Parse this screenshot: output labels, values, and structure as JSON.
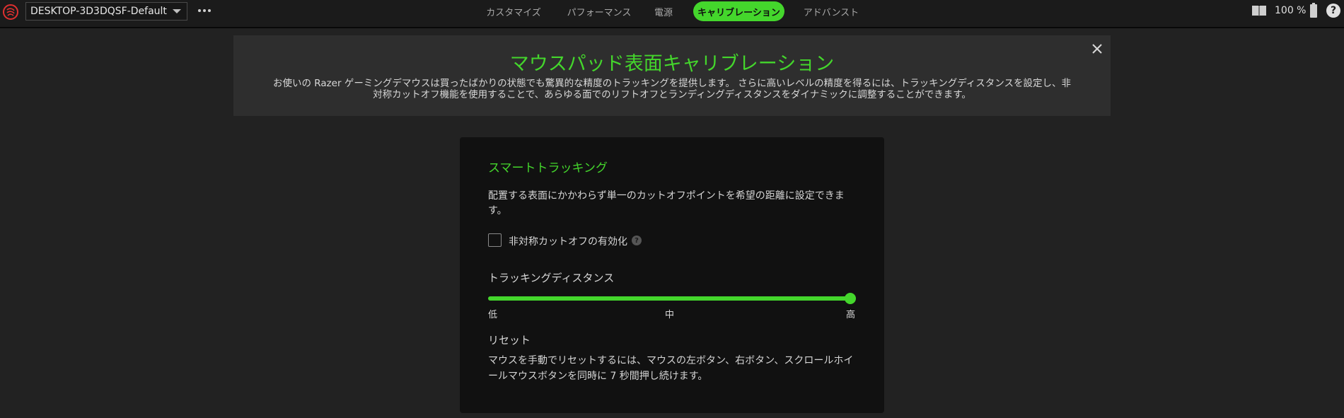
{
  "topbar": {
    "profile": "DESKTOP-3D3DQSF-Default",
    "tabs": [
      {
        "label": "カスタマイズ"
      },
      {
        "label": "パフォーマンス"
      },
      {
        "label": "電源"
      },
      {
        "label": "キャリブレーション",
        "active": true
      },
      {
        "label": "アドバンスト"
      }
    ],
    "battery_percent": "100 %",
    "help_label": "?"
  },
  "banner": {
    "title": "マウスパッド表面キャリブレーション",
    "description_line1": "お使いの Razer ゲーミングデマウスは買ったばかりの状態でも驚異的な精度のトラッキングを提供します。 さらに高いレベルの精度を得るには、トラッキングディスタンスを設定し、非",
    "description_line2": "対称カットオフ機能を使用することで、あらゆる面でのリフトオフとランディングディスタンスをダイナミックに調整することができます。"
  },
  "smart_tracking": {
    "title": "スマートトラッキング",
    "description": "配置する表面にかかわらず単一のカットオフポイントを希望の距離に設定できます。",
    "asymmetric_label": "非対称カットオフの有効化",
    "asymmetric_checked": false,
    "help_label": "?",
    "distance_title": "トラッキングディスタンス",
    "distance_value": 1.0,
    "tick_low": "低",
    "tick_mid": "中",
    "tick_high": "高",
    "reset_title": "リセット",
    "reset_description": "マウスを手動でリセットするには、マウスの左ボタン、右ボタン、スクロールホイールマウスボタンを同時に 7 秒間押し続けます。"
  },
  "colors": {
    "accent": "#44d62c",
    "background": "#222222",
    "card": "#111111"
  }
}
